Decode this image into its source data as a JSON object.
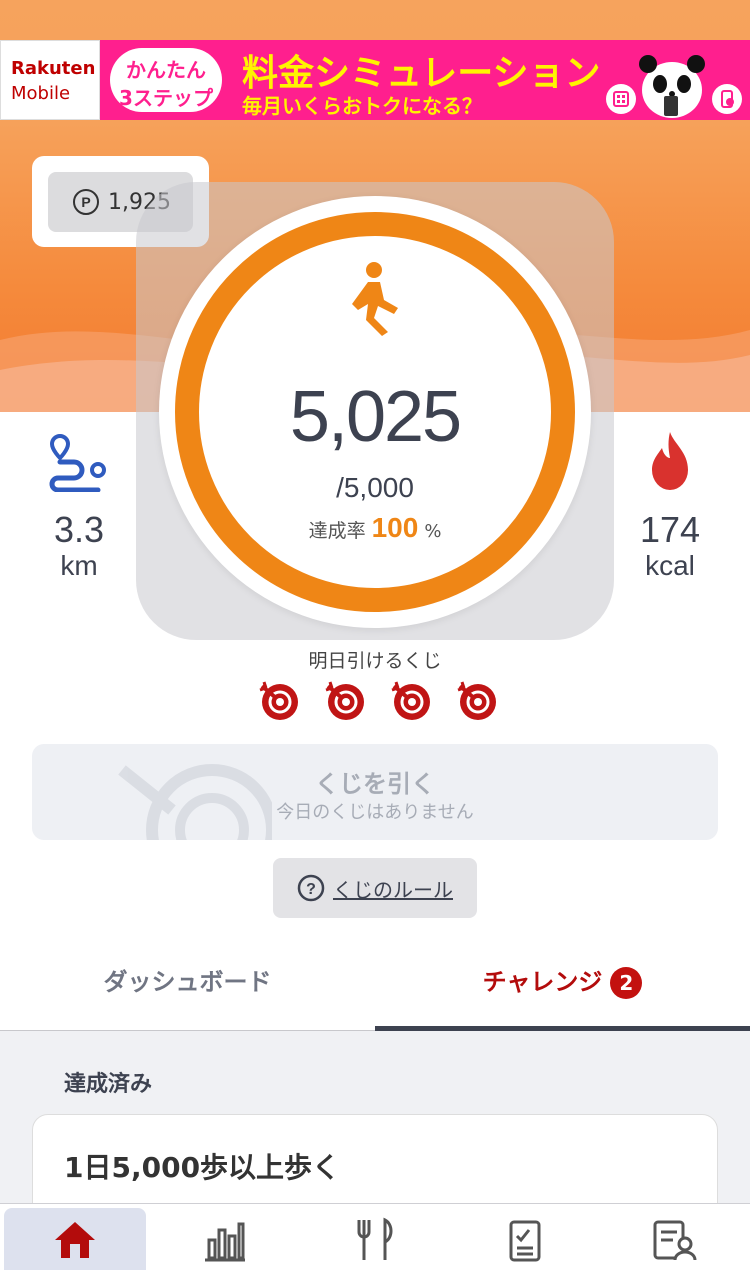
{
  "banner": {
    "brand": "Rakuten",
    "brand_sub": "Mobile",
    "pill_line1": "かんたん",
    "pill_line2": "3ステップ",
    "title": "料金シミュレーション",
    "subtitle": "毎月いくらおトクになる？"
  },
  "points": {
    "value": "1,925",
    "icon": "points-icon"
  },
  "steps": {
    "value": "5,025",
    "goal": "/5,000",
    "rate_label": "達成率",
    "rate_value": "100",
    "rate_unit": "%",
    "progress": 1.0
  },
  "distance": {
    "value": "3.3",
    "unit": "km",
    "icon": "route-icon"
  },
  "calories": {
    "value": "174",
    "unit": "kcal",
    "icon": "flame-icon"
  },
  "lottery": {
    "label": "明日引けるくじ",
    "tickets": 4,
    "button_title": "くじを引く",
    "button_sub": "今日のくじはありません",
    "rule_label": "くじのルール"
  },
  "tabs": {
    "dashboard": "ダッシュボード",
    "challenge": "チャレンジ",
    "challenge_badge": "2"
  },
  "content": {
    "section_title": "達成済み",
    "card_title": "1日5,000歩以上歩く"
  },
  "nav": [
    "home-icon",
    "chart-icon",
    "meal-icon",
    "checklist-icon",
    "profile-icon"
  ],
  "colors": {
    "accent": "#ef8616",
    "challenge": "#b30c0c",
    "banner": "#ff1f8e"
  }
}
